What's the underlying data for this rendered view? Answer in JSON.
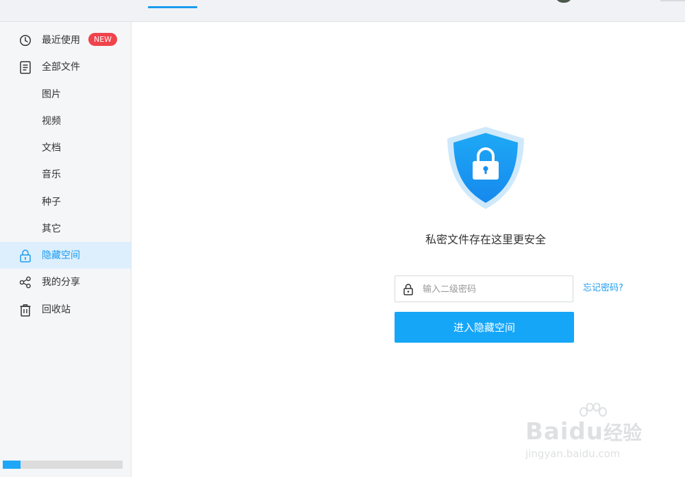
{
  "sidebar": {
    "items": [
      {
        "label": "最近使用",
        "icon": "clock-icon",
        "badge": "NEW"
      },
      {
        "label": "全部文件",
        "icon": "document-icon"
      },
      {
        "label": "图片"
      },
      {
        "label": "视频"
      },
      {
        "label": "文档"
      },
      {
        "label": "音乐"
      },
      {
        "label": "种子"
      },
      {
        "label": "其它"
      },
      {
        "label": "隐藏空间",
        "icon": "lock-icon",
        "active": true
      },
      {
        "label": "我的分享",
        "icon": "share-icon"
      },
      {
        "label": "回收站",
        "icon": "trash-icon"
      }
    ],
    "storage_progress": 0.15
  },
  "main": {
    "subtitle": "私密文件存在这里更安全",
    "password_placeholder": "输入二级密码",
    "password_value": "",
    "forgot_link": "忘记密码?",
    "enter_button": "进入隐藏空间"
  },
  "watermark": {
    "brand": "Bai",
    "brand_mid": "du",
    "brand_cn": "经验",
    "url": "jingyan.baidu.com"
  },
  "colors": {
    "accent": "#1a9bf0",
    "button": "#15a6f8",
    "badge": "#f0434c",
    "active_bg": "#ddeffd"
  }
}
